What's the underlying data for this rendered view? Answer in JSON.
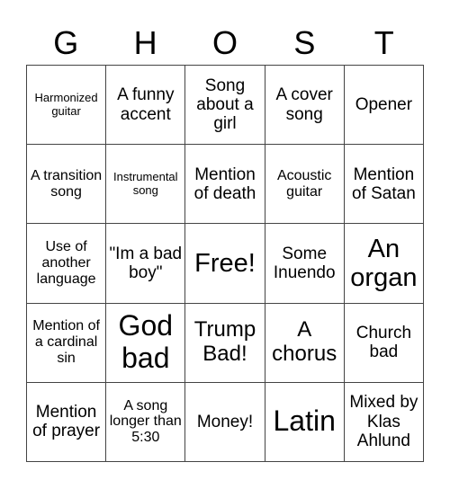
{
  "header": {
    "letters": [
      "G",
      "H",
      "O",
      "S",
      "T"
    ]
  },
  "board": {
    "rows": [
      [
        "Harmonized guitar",
        "A funny accent",
        "Song about a girl",
        "A cover song",
        "Opener"
      ],
      [
        "A transition song",
        "Instrumental song",
        "Mention of death",
        "Acoustic guitar",
        "Mention of Satan"
      ],
      [
        "Use of another language",
        "\"Im a bad boy\"",
        "Free!",
        "Some Inuendo",
        "An organ"
      ],
      [
        "Mention of a cardinal sin",
        "God bad",
        "Trump Bad!",
        "A chorus",
        "Church bad"
      ],
      [
        "Mention of prayer",
        "A song longer than 5:30",
        "Money!",
        "Latin",
        "Mixed by Klas Ahlund"
      ]
    ],
    "free_space": "Free!"
  }
}
